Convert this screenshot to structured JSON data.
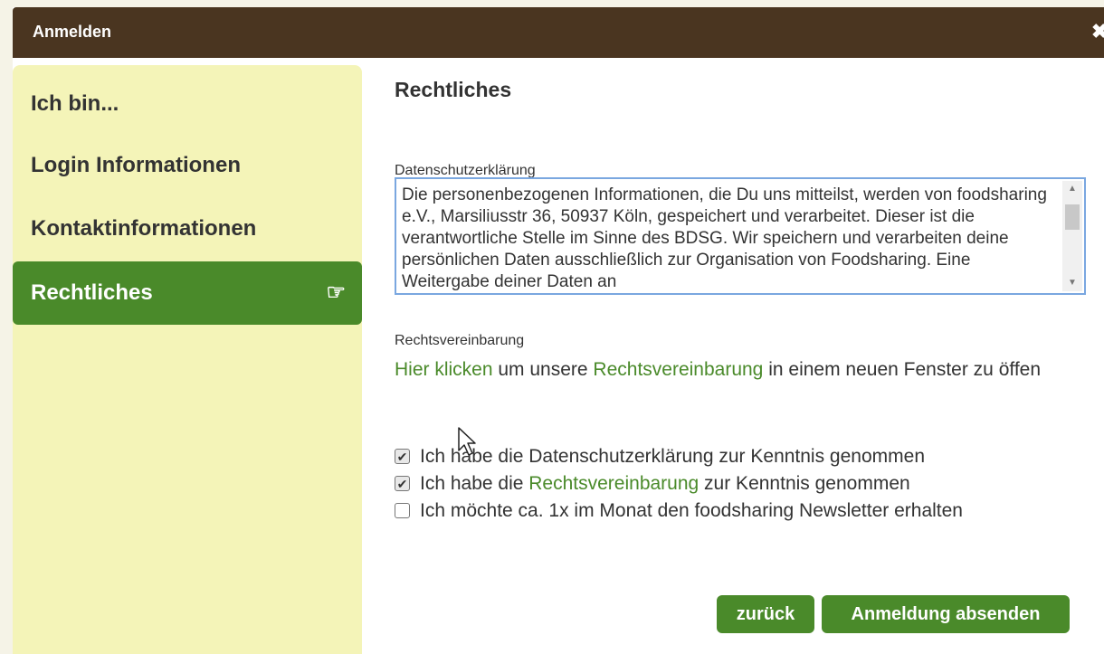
{
  "dialog": {
    "title": "Anmelden",
    "close_glyph": "✖"
  },
  "sidebar": {
    "items": [
      {
        "label": "Ich bin..."
      },
      {
        "label": "Login Informationen"
      },
      {
        "label": "Kontaktinformationen"
      },
      {
        "label": "Rechtliches",
        "active": true,
        "icon": "hand-pointing-right-icon"
      }
    ],
    "active_icon_glyph": "☞"
  },
  "content": {
    "heading": "Rechtliches",
    "privacy_label": "Datenschutzerklärung",
    "privacy_text": "Die personenbezogenen Informationen, die Du uns mitteilst, werden von foodsharing e.V., Marsiliusstr 36, 50937 Köln, gespeichert und verarbeitet. Dieser ist die verantwortliche  Stelle im Sinne des BDSG. Wir speichern und verarbeiten deine persönlichen Daten ausschließlich zur Organisation von Foodsharing. Eine Weitergabe deiner Daten an",
    "agreement_label": "Rechtsvereinbarung",
    "agreement_link1": "Hier klicken",
    "agreement_text1": " um unsere ",
    "agreement_link2": "Rechtsvereinbarung",
    "agreement_text2": " in einem neuen Fenster zu öffen",
    "checkboxes": [
      {
        "text": "Ich habe die Datenschutzerklärung zur Kenntnis genommen",
        "checked": true
      },
      {
        "pre": "Ich habe die ",
        "link": "Rechtsvereinbarung",
        "post": " zur Kenntnis genommen",
        "checked": true
      },
      {
        "text": "Ich möchte ca. 1x im Monat den foodsharing Newsletter erhalten",
        "checked": false
      }
    ],
    "check_glyph": "✔",
    "back_button": "zurück",
    "submit_button": "Anmeldung absenden"
  },
  "colors": {
    "titlebar": "#4a3520",
    "sidebar": "#f4f4b8",
    "accent_green": "#4a8a2a",
    "textarea_border": "#7aa7e0"
  }
}
